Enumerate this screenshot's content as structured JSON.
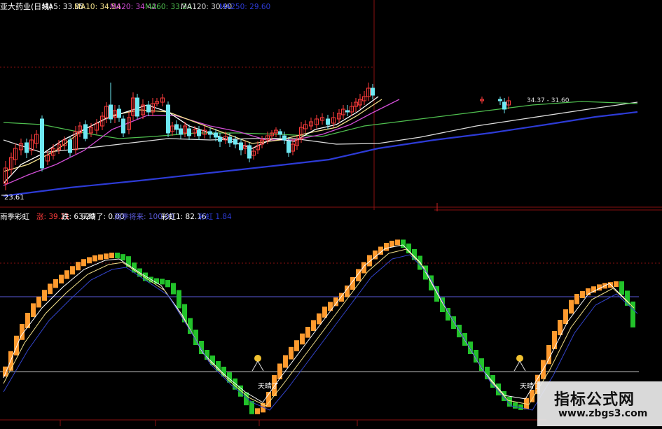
{
  "colors": {
    "background": "#000000",
    "up": "#ff3b3b",
    "down": "#6ee8f2",
    "ma5": "#ffffff",
    "ma10": "#f2e08a",
    "ma20": "#d24ed6",
    "ma60": "#4fbf4f",
    "ma120": "#dddddd",
    "ma250": "#2d3bd6",
    "rise_bar": "#ff9a2e",
    "fall_bar": "#22c22a",
    "ref_line": "#5a5ad8",
    "grid_red": "#8a1010"
  },
  "price_panel": {
    "title": "亚大药业(日线)",
    "ma_labels": [
      {
        "text": "MA5: 33.35",
        "color": "#ffffff"
      },
      {
        "text": "MA10: 34.54",
        "color": "#f2e08a"
      },
      {
        "text": "MA20: 34.42",
        "color": "#d24ed6"
      },
      {
        "text": "MA60: 33.24",
        "color": "#4fbf4f"
      },
      {
        "text": "MA120: 30.90",
        "color": "#dddddd"
      },
      {
        "text": "MA250: 29.60",
        "color": "#2d3bd6"
      }
    ],
    "low_label": "23.61",
    "price_annotation": "34.37 - 31.60"
  },
  "indicator_panel": {
    "name": "雨季彩虹",
    "labels": [
      {
        "text": "涨: 39.21",
        "color": "#ff3b3b"
      },
      {
        "text": "跌: 63.20",
        "color": "#ffffff"
      },
      {
        "text": "天晴了: 0.00",
        "color": "#ffffff"
      },
      {
        "text": "雨季将来: 100.00",
        "color": "#5a5ad8"
      },
      {
        "text": "彩虹1: 82.16",
        "color": "#ffffff"
      },
      {
        "text": "彩虹 1.84",
        "color": "#2d3bd6"
      }
    ],
    "signal_text": "天晴了"
  },
  "watermark": {
    "main": "指标公式网",
    "url": "www.zbgs3.com"
  }
}
